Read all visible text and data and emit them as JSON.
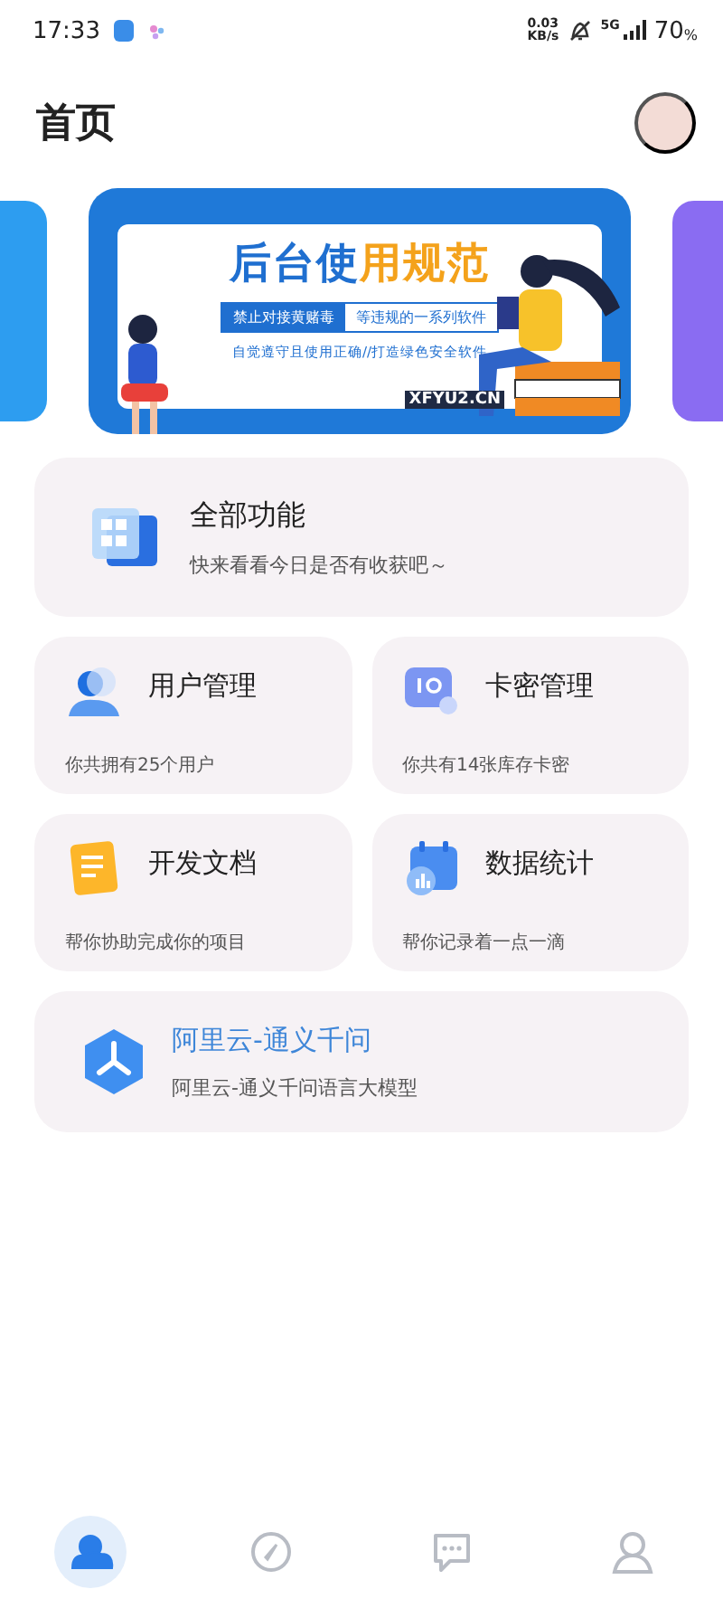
{
  "status_bar": {
    "time": "17:33",
    "net_speed": "0.03",
    "net_unit": "KB/s",
    "network": "5G",
    "battery": "70",
    "battery_unit": "%"
  },
  "header": {
    "title": "首页"
  },
  "banner": {
    "title_blue": "后台使",
    "title_orange": "用规范",
    "tag_left": "禁止对接黄赌毒",
    "tag_right": "等违规的一系列软件",
    "subtitle": "自觉遵守且使用正确//打造绿色安全软件",
    "site": "XFYU2.CN"
  },
  "feature_card": {
    "title": "全部功能",
    "subtitle": "快来看看今日是否有收获吧～"
  },
  "tiles": [
    {
      "kind": "users",
      "title": "用户管理",
      "subtitle": "你共拥有25个用户"
    },
    {
      "kind": "cards",
      "title": "卡密管理",
      "subtitle": "你共有14张库存卡密"
    },
    {
      "kind": "docs",
      "title": "开发文档",
      "subtitle": "帮你协助完成你的项目"
    },
    {
      "kind": "stats",
      "title": "数据统计",
      "subtitle": "帮你记录着一点一滴"
    }
  ],
  "ai_card": {
    "title": "阿里云-通义千问",
    "subtitle": "阿里云-通义千问语言大模型"
  },
  "bottom_nav": [
    {
      "kind": "home",
      "selected": true
    },
    {
      "kind": "discover",
      "selected": false
    },
    {
      "kind": "messages",
      "selected": false
    },
    {
      "kind": "profile",
      "selected": false
    }
  ]
}
